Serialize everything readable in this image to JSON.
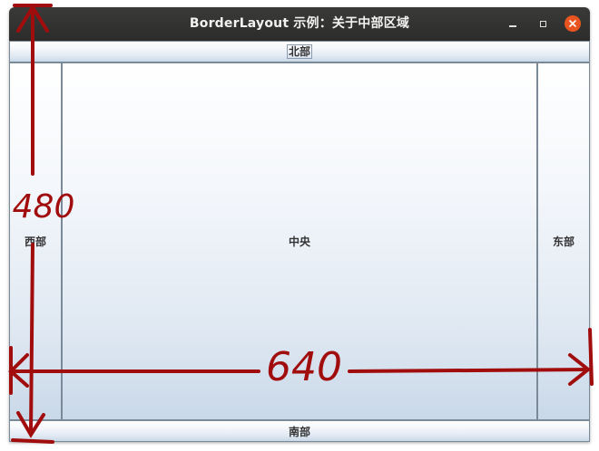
{
  "window": {
    "title": "BorderLayout 示例：关于中部区域",
    "controls": {
      "minimize_icon": "minimize-icon",
      "maximize_icon": "maximize-icon",
      "close_icon": "close-icon",
      "close_color": "#e95420"
    }
  },
  "layout": {
    "north_label": "北部",
    "south_label": "南部",
    "west_label": "西部",
    "east_label": "东部",
    "center_label": "中央"
  },
  "annotation": {
    "width_label": "640",
    "height_label": "480",
    "color": "#a10d0d"
  }
}
